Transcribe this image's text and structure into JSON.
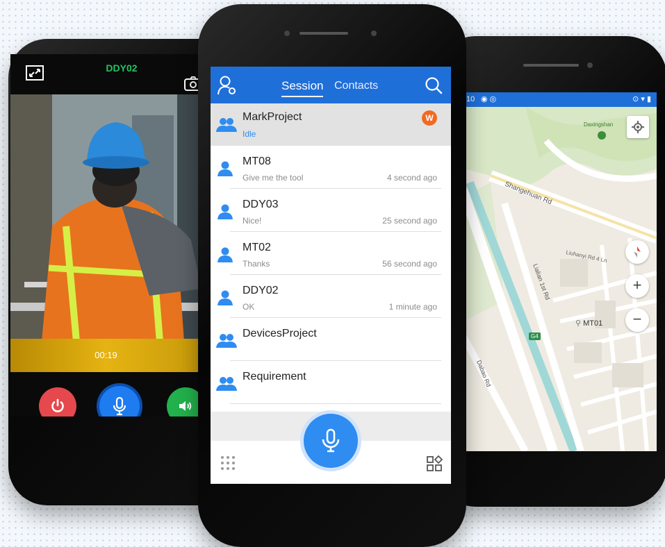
{
  "left_phone": {
    "contact_name": "DDY02",
    "call_timer": "00:19",
    "colors": {
      "name": "#22c55e",
      "hangup": "#e5484d",
      "mic": "#1e7bf0",
      "speaker": "#22b14c",
      "bar": "#e5b312"
    }
  },
  "center_phone": {
    "tabs": [
      {
        "label": "Session"
      },
      {
        "label": "Contacts"
      }
    ],
    "active_tab": "Session",
    "sessions": [
      {
        "name": "MarkProject",
        "message": "Idle",
        "time": "",
        "type": "group",
        "badge": "W"
      },
      {
        "name": "MT08",
        "message": "Give me the tool",
        "time": "4 second ago",
        "type": "user"
      },
      {
        "name": "DDY03",
        "message": "Nice!",
        "time": "25 second ago",
        "type": "user"
      },
      {
        "name": "MT02",
        "message": "Thanks",
        "time": "56 second ago",
        "type": "user"
      },
      {
        "name": "DDY02",
        "message": "OK",
        "time": "1 minute ago",
        "type": "user"
      },
      {
        "name": "DevicesProject",
        "message": "",
        "time": "",
        "type": "group"
      },
      {
        "name": "Requirement",
        "message": "",
        "time": "",
        "type": "group"
      }
    ],
    "colors": {
      "primary": "#1f6fd9",
      "badge": "#f26a21",
      "idle": "#2f8cf0"
    }
  },
  "right_phone": {
    "status_time": "10",
    "map_labels": {
      "park": "Daxingshan",
      "road1": "Shangehuan Rd",
      "road2": "Liuhanyi Rd 4 Ln",
      "road3": "Lialian 1st Rd",
      "road4": "Dabao Rd",
      "highway": "G4",
      "marker": "MT01"
    },
    "zoom_in": "+",
    "zoom_out": "−"
  }
}
